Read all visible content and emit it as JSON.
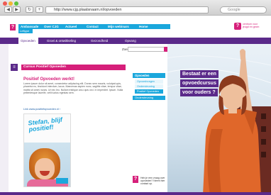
{
  "browser": {
    "url": "http://www.cjg.plaatsnaam.nl/opvoeden",
    "search_placeholder": "Google",
    "back_label": "◀",
    "forward_label": "▶",
    "reload_label": "↻",
    "add_label": "+"
  },
  "header": {
    "logo_letter": "?",
    "nav": [
      "Ambassade",
      "Over CJG",
      "Actueel",
      "Contact",
      "Mijn webinars",
      "Home"
    ],
    "subtab": "Leftype",
    "brand_letter": "?",
    "brand_text": "centrum voor jeugd en gezin"
  },
  "purple_nav": [
    "Opvoeden",
    "Groei & ontwikkeling",
    "Gezondheid",
    "Opvang"
  ],
  "search": {
    "label": "Zoek",
    "value": ""
  },
  "section": {
    "bar_title": "Cursus Positief Opvoeden",
    "article_title": "Positief Opvoeden werkt!",
    "article_text": "Lorem ipsum dolor sit amet, consectetur adipiscing elit. Donec sem mauris, volutpat quis, pharetra eu, tincidunt interdum, lacus. Maecenas sapien nunc, sagittis vitae, tempor vitae, mattis sit amet, turpis. Ut nec leo. Nullam tristique arcu quis orci. In imperdiet. Ipsum. Nulla pellentesque laoreet, velit luctus egestas sem.",
    "link": "Link www.positiefopvoeden.nl ›",
    "postcard_text": "Stefan, blijf positief!"
  },
  "sidenav": {
    "head": "Opvoeden",
    "items": [
      "Opvoedvragen",
      "Ondersteuning",
      "Positief Opvoeden"
    ],
    "selected": 2,
    "bottom": "Ondersteuning"
  },
  "help": {
    "letter": "?",
    "text": "Heb je een vraag over opvoeden? Neem hier contact op."
  },
  "hero": {
    "line1": "Bestaat er een",
    "line2": "opvoedcursus",
    "line3": "voor ouders ?"
  },
  "colors": {
    "purple": "#5b2a8a",
    "magenta": "#d61f7a",
    "cyan": "#1aa7dc"
  }
}
